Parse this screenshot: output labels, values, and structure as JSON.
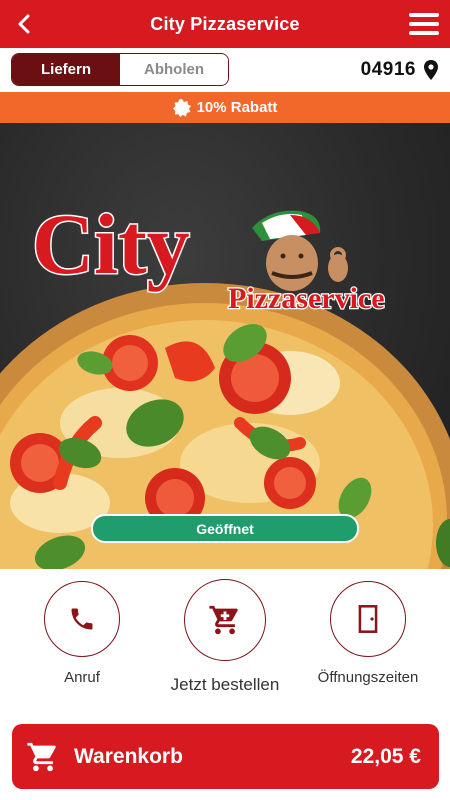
{
  "header": {
    "title": "City Pizzaservice",
    "back_icon": "chevron-left-icon",
    "menu_icon": "hamburger-menu-icon",
    "color": "#d71920"
  },
  "delivery_mode": {
    "options": [
      "Liefern",
      "Abholen"
    ],
    "selected": "Liefern",
    "postal_code": "04916",
    "location_icon": "map-pin-icon"
  },
  "promo": {
    "text": "10% Rabatt",
    "icon": "badge-icon",
    "color": "#f2672a"
  },
  "hero": {
    "logo_main": "City",
    "logo_sub": "Pizzaservice",
    "status_label": "Geöffnet",
    "status_color": "#1f9d6c"
  },
  "actions": [
    {
      "label": "Anruf",
      "icon": "phone-icon"
    },
    {
      "label": "Jetzt bestellen",
      "icon": "cart-icon"
    },
    {
      "label": "Öffnungszeiten",
      "icon": "door-icon"
    }
  ],
  "cart": {
    "label": "Warenkorb",
    "total": "22,05 €",
    "icon": "cart-icon"
  }
}
